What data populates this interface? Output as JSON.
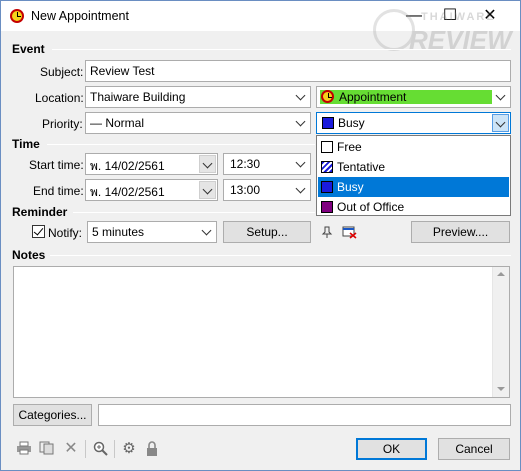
{
  "window": {
    "title": "New Appointment",
    "minimize": "—",
    "maximize": "☐",
    "close": "✕"
  },
  "watermark": {
    "line1": "THAIWARE",
    "line2": "REVIEW"
  },
  "sections": {
    "event": "Event",
    "time": "Time",
    "reminder": "Reminder",
    "notes": "Notes"
  },
  "event": {
    "subject_label": "Subject:",
    "subject_value": "Review Test",
    "location_label": "Location:",
    "location_value": "Thaiware Building",
    "type_value": "Appointment",
    "priority_label": "Priority:",
    "priority_value": "— Normal",
    "status_value": "Busy"
  },
  "status_options": [
    {
      "label": "Free",
      "color": "#ffffff"
    },
    {
      "label": "Tentative",
      "color": "#1a1adc"
    },
    {
      "label": "Busy",
      "color": "#1a1adc"
    },
    {
      "label": "Out of Office",
      "color": "#800080"
    }
  ],
  "time": {
    "start_label": "Start time:",
    "start_date": "พ.  14/02/2561",
    "start_time": "12:30",
    "end_label": "End time:",
    "end_date": "พ.  14/02/2561",
    "end_time": "13:00"
  },
  "reminder": {
    "notify_label": "Notify:",
    "notify_checked": true,
    "notify_value": "5 minutes",
    "setup_label": "Setup...",
    "preview_label": "Preview...."
  },
  "bottom": {
    "categories_label": "Categories...",
    "categories_value": "",
    "ok_label": "OK",
    "cancel_label": "Cancel"
  },
  "colors": {
    "appointment_green": "#66dd33",
    "selection_blue": "#0078d7",
    "busy_blue": "#1a1adc",
    "out_of_office": "#800080"
  }
}
